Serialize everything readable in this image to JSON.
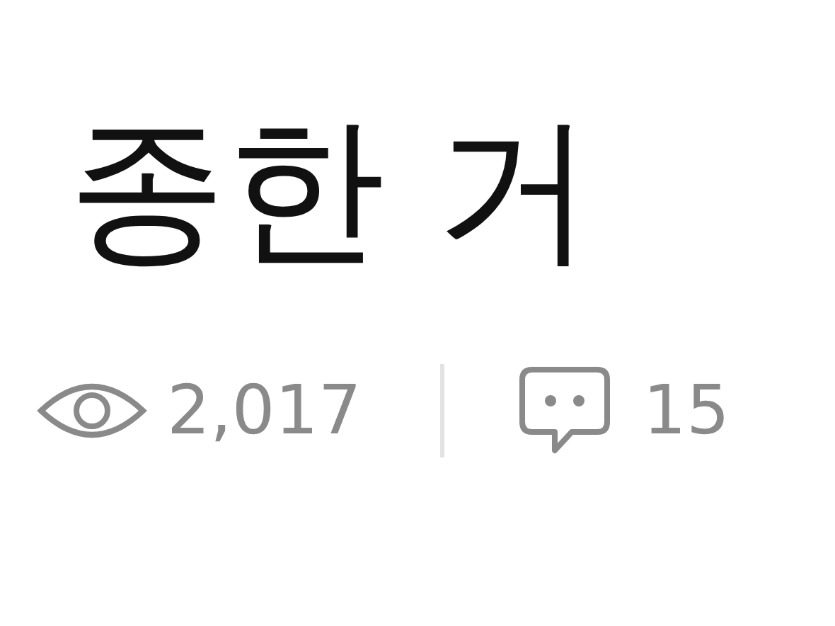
{
  "post": {
    "title": "종한 거",
    "views": "2,017",
    "comments": "15"
  }
}
